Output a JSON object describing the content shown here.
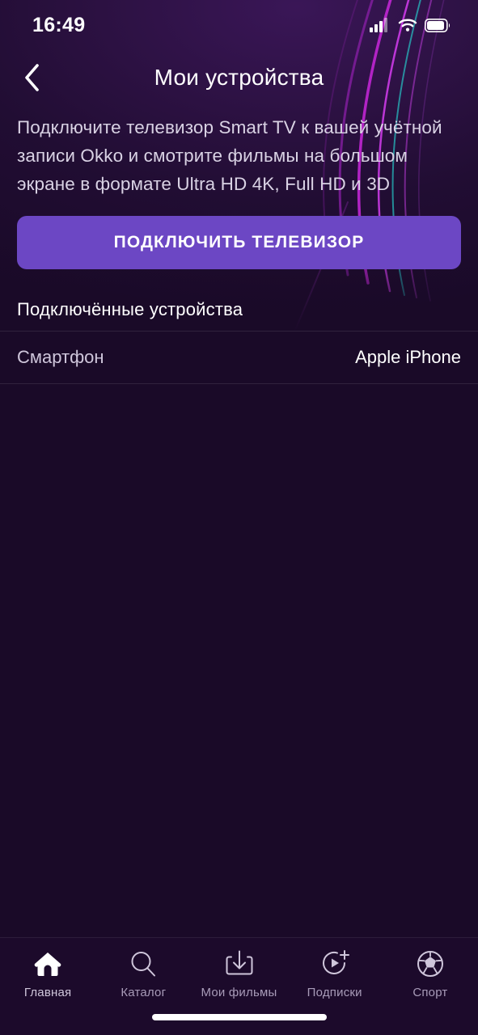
{
  "status_bar": {
    "time": "16:49",
    "signal_icon": "cellular-signal-icon",
    "wifi_icon": "wifi-icon",
    "battery_icon": "battery-icon"
  },
  "nav": {
    "back_icon": "chevron-left-icon",
    "title": "Мои устройства"
  },
  "promo": {
    "description": "Подключите телевизор Smart TV к вашей учётной записи Okko и смотрите фильмы на большом экране в формате Ultra HD 4K, Full HD и 3D",
    "cta_label": "ПОДКЛЮЧИТЬ ТЕЛЕВИЗОР"
  },
  "devices": {
    "section_title": "Подключённые устройства",
    "rows": [
      {
        "type": "Смартфон",
        "name": "Apple iPhone"
      }
    ]
  },
  "tabbar": {
    "items": [
      {
        "label": "Главная",
        "icon": "home-icon",
        "active": true
      },
      {
        "label": "Каталог",
        "icon": "search-icon",
        "active": false
      },
      {
        "label": "Мои фильмы",
        "icon": "download-icon",
        "active": false
      },
      {
        "label": "Подписки",
        "icon": "play-plus-icon",
        "active": false
      },
      {
        "label": "Спорт",
        "icon": "soccer-ball-icon",
        "active": false
      }
    ]
  },
  "colors": {
    "accent": "#6c47c4",
    "background": "#1a0a28",
    "header": "#2c1142",
    "text_primary": "#ffffff",
    "text_secondary": "#cfc6db"
  }
}
